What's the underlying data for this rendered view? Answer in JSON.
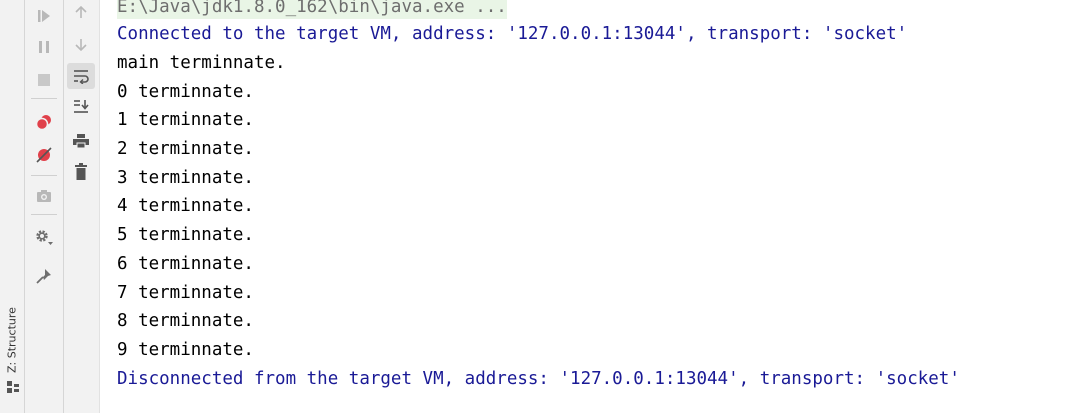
{
  "sidebar": {
    "structure_label": "Z: Structure"
  },
  "toolbar": {
    "buttons": [
      {
        "id": "resume",
        "icon": "resume-icon"
      },
      {
        "id": "pause",
        "icon": "pause-icon"
      },
      {
        "id": "stop",
        "icon": "stop-icon"
      },
      {
        "id": "view-breakpoints",
        "icon": "breakpoints-icon"
      },
      {
        "id": "mute-breakpoints",
        "icon": "mute-breakpoints-icon"
      },
      {
        "id": "camera",
        "icon": "camera-icon"
      },
      {
        "id": "settings",
        "icon": "gear-icon"
      },
      {
        "id": "pin",
        "icon": "pin-icon"
      }
    ],
    "secondary": [
      {
        "id": "up",
        "icon": "arrow-up-icon"
      },
      {
        "id": "down",
        "icon": "arrow-down-icon"
      },
      {
        "id": "soft-wrap",
        "icon": "soft-wrap-icon"
      },
      {
        "id": "scroll-to-end",
        "icon": "scroll-end-icon"
      },
      {
        "id": "print",
        "icon": "print-icon"
      },
      {
        "id": "clear",
        "icon": "trash-icon"
      }
    ]
  },
  "console": {
    "command": "E:\\Java\\jdk1.8.0_162\\bin\\java.exe ...",
    "connected": "Connected to the target VM, address: '127.0.0.1:13044', transport: 'socket'",
    "output": [
      "main terminnate.",
      "0 terminnate.",
      "1 terminnate.",
      "2 terminnate.",
      "3 terminnate.",
      "4 terminnate.",
      "5 terminnate.",
      "6 terminnate.",
      "7 terminnate.",
      "8 terminnate.",
      "9 terminnate."
    ],
    "disconnected": "Disconnected from the target VM, address: '127.0.0.1:13044', transport: 'socket'"
  },
  "colors": {
    "system_text": "#1a1a96",
    "command_text": "#6e6e6e",
    "command_highlight": "#e9f5e6",
    "breakpoint_red": "#e0404a"
  }
}
